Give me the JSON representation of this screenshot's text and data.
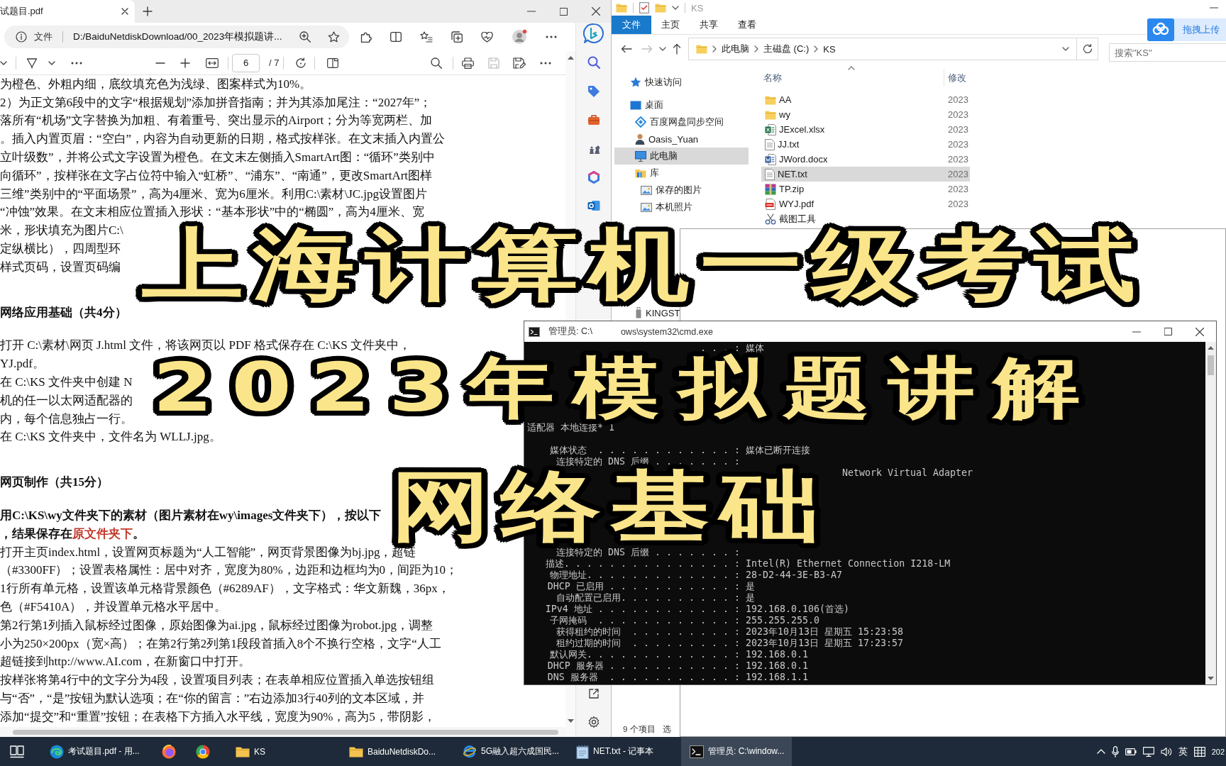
{
  "pdf_viewer": {
    "tab_title": "试题目.pdf",
    "address": {
      "scheme": "文件",
      "url": "D:/BaiduNetdiskDownload/00_2023年模拟题讲..."
    },
    "toolbar": {
      "page": "6",
      "total": "/ 7",
      "save_disabled": true
    },
    "lines": [
      {
        "kind": "text",
        "text": "为橙色、外粗内细，底纹填充色为浅绿、图案样式为10%。"
      },
      {
        "kind": "text",
        "text": "2）为正文第6段中的文字“根据规划”添加拼音指南；并为其添加尾注：“2027年”；"
      },
      {
        "kind": "text",
        "text": "落所有“机场”文字替换为加粗、有着重号、突出显示的Airport；分为等宽两栏、加"
      },
      {
        "kind": "text",
        "text": "。插入内置页眉：“空白”，内容为自动更新的日期，格式按样张。在文末插入内置公"
      },
      {
        "kind": "text",
        "text": "立叶级数”，并将公式文字设置为橙色。在文末左侧插入SmartArt图：“循环”类别中"
      },
      {
        "kind": "text",
        "text": "向循环”，按样张在文字占位符中输入“虹桥”、“浦东”、“南通”，更改SmartArt图样"
      },
      {
        "kind": "text",
        "text": "三维”类别中的“平面场景”，高为4厘米、宽为6厘米。利用C:\\素材\\JC.jpg设置图片"
      },
      {
        "kind": "text",
        "text": "“冲蚀”效果。在文末相应位置插入形状：“基本形状”中的“椭圆”，高为4厘米、宽"
      },
      {
        "kind": "text",
        "text": "米，形状填充为图片C:\\"
      },
      {
        "kind": "text",
        "text": "定纵横比），四周型环"
      },
      {
        "kind": "text",
        "text": "样式页码，设置页码编"
      },
      {
        "kind": "heading",
        "text": "网络应用基础（共4分）"
      },
      {
        "kind": "text",
        "text": "打开 C:\\素材\\网页 J.html 文件，将该网页以 PDF 格式保存在 C:\\KS 文件夹中，"
      },
      {
        "kind": "text",
        "text": "YJ.pdf。"
      },
      {
        "kind": "text",
        "text": "在 C:\\KS 文件夹中创建 N"
      },
      {
        "kind": "text",
        "text": "机的任一以太网适配器的"
      },
      {
        "kind": "text",
        "text": "内，每个信息独占一行。"
      },
      {
        "kind": "text",
        "text": "在 C:\\KS 文件夹中，文件名为 WLLJ.jpg。"
      },
      {
        "kind": "heading",
        "text": "网页制作（共15分）"
      },
      {
        "kind": "bold",
        "text": "用C:\\KS\\wy文件夹下的素材（图片素材在wy\\images文件夹下），按以下"
      },
      {
        "kind": "bold",
        "segments": [
          {
            "text": "，结果保存在",
            "highlight": false
          },
          {
            "text": "原文件夹下",
            "highlight": true
          },
          {
            "text": "。",
            "highlight": false
          }
        ]
      },
      {
        "kind": "text",
        "text": "打开主页index.html，设置网页标题为“人工智能”，网页背景图像为bj.jpg，超链"
      },
      {
        "kind": "text",
        "text": "（#3300FF）；设置表格属性：居中对齐，宽度为80%，边距和边框均为0，间距为10；"
      },
      {
        "kind": "text",
        "text": "1行所有单元格，设置该单元格背景颜色（#6289AF），文字格式：华文新魏，36px，"
      },
      {
        "kind": "text",
        "text": "色（#F5410A），并设置单元格水平居中。"
      },
      {
        "kind": "text",
        "text": "第2行第1列插入鼠标经过图像，原始图像为ai.jpg，鼠标经过图像为robot.jpg，调整"
      },
      {
        "kind": "text",
        "text": "小为250×200px（宽×高）；在第2行第2列第1段段首插入8个不换行空格，文字“人工"
      },
      {
        "kind": "text",
        "text": "超链接到http://www.AI.com，在新窗口中打开。"
      },
      {
        "kind": "text",
        "text": "按样张将第4行中的文字分为4段，设置项目列表；在表单相应位置插入单选按钮组"
      },
      {
        "kind": "text",
        "text": "与“否”，“是”按钮为默认选项；在“你的留言：”右边添加3行40列的文本区域，并"
      },
      {
        "kind": "text",
        "text": "添加“提交”和“重置”按钮；在表格下方插入水平线，宽度为90%，高为5，带阴影，"
      }
    ]
  },
  "explorer": {
    "title": "KS",
    "ribbon_tabs": [
      {
        "label": "文件",
        "selected": true
      },
      {
        "label": "主页",
        "selected": false
      },
      {
        "label": "共享",
        "selected": false
      },
      {
        "label": "查看",
        "selected": false
      }
    ],
    "forward_disabled": true,
    "breadcrumb": [
      "此电脑",
      "主磁盘 (C:)",
      "KS"
    ],
    "search": {
      "placeholder": "搜索\"KS\""
    },
    "upload_button": "拖拽上传",
    "nav": [
      {
        "label": "快速访问",
        "kind": "star",
        "selected": false
      },
      {
        "label": "桌面",
        "kind": "desktop",
        "selected": false,
        "children": [
          {
            "label": "百度网盘同步空间",
            "kind": "sync",
            "selected": false
          },
          {
            "label": "Oasis_Yuan",
            "kind": "user",
            "selected": false
          },
          {
            "label": "此电脑",
            "kind": "pc",
            "selected": true
          },
          {
            "label": "库",
            "kind": "library",
            "selected": false,
            "children": [
              {
                "label": "保存的图片",
                "kind": "picture",
                "selected": false
              },
              {
                "label": "本机照片",
                "kind": "picture",
                "selected": false
              }
            ]
          },
          {
            "label": "KINGST",
            "kind": "drive",
            "selected": false
          }
        ]
      }
    ],
    "columns": [
      "名称",
      "修改"
    ],
    "files": [
      {
        "name": "AA",
        "kind": "folder",
        "date": "2023",
        "selected": false
      },
      {
        "name": "wy",
        "kind": "folder",
        "date": "2023",
        "selected": false
      },
      {
        "name": "JExcel.xlsx",
        "kind": "spreadsheet",
        "date": "2023",
        "selected": false
      },
      {
        "name": "JJ.txt",
        "kind": "text",
        "date": "2023",
        "selected": false
      },
      {
        "name": "JWord.docx",
        "kind": "document",
        "date": "2023",
        "selected": false
      },
      {
        "name": "NET.txt",
        "kind": "text",
        "date": "2023",
        "selected": true
      },
      {
        "name": "TP.zip",
        "kind": "archive",
        "date": "2023",
        "selected": false
      },
      {
        "name": "WYJ.pdf",
        "kind": "pdf",
        "date": "2023",
        "selected": false
      },
      {
        "name": "截图工具",
        "kind": "shortcut",
        "selected": false
      }
    ],
    "status": {
      "count": "9 个项目",
      "selection": "选"
    }
  },
  "cmd": {
    "title_parts": [
      "管理员: C:\\",
      "ows\\system32\\cmd.exe"
    ],
    "sections": [
      {
        "lines": [
          {
            "kind": "entry",
            "label": ". . . :",
            "value": "媒体"
          }
        ]
      },
      {
        "lines": [
          {
            "kind": "header",
            "text": "适配器 本地连接* 1"
          },
          {
            "kind": "entry",
            "label": "媒体状态  . . . . . . . . . . . . :",
            "value": "媒体已断开连接"
          },
          {
            "kind": "entry",
            "label": "连接特定的 DNS 后缀 . . . . . . . :"
          }
        ]
      },
      {
        "lines": [
          {
            "kind": "tail",
            "value": "Network Virtual Adapter"
          }
        ]
      },
      {
        "lines": [
          {
            "kind": "entry",
            "label": "连接特定的 DNS 后缀 . . . . . . . :"
          },
          {
            "kind": "entry",
            "label": "描述. . . . . . . . . . . . . . . :",
            "value": "Intel(R) Ethernet Connection I218-LM"
          },
          {
            "kind": "entry",
            "label": "物理地址. . . . . . . . . . . . . :",
            "value": "28-D2-44-3E-B3-A7"
          },
          {
            "kind": "entry",
            "label": "DHCP 已启用 . . . . . . . . . . . :",
            "value": "是"
          },
          {
            "kind": "entry",
            "label": "自动配置已启用. . . . . . . . . . :",
            "value": "是"
          },
          {
            "kind": "entry",
            "label": "IPv4 地址 . . . . . . . . . . . . :",
            "value": "192.168.0.106(首选)"
          },
          {
            "kind": "entry",
            "label": "子网掩码  . . . . . . . . . . . . :",
            "value": "255.255.255.0"
          },
          {
            "kind": "entry",
            "label": "获得租约的时间  . . . . . . . . . :",
            "value": "2023年10月13日 星期五 15:23:58"
          },
          {
            "kind": "entry",
            "label": "租约过期的时间  . . . . . . . . . :",
            "value": "2023年10月13日 星期五 17:23:57"
          },
          {
            "kind": "entry",
            "label": "默认网关. . . . . . . . . . . . . :",
            "value": "192.168.0.1"
          },
          {
            "kind": "entry",
            "label": "DHCP 服务器 . . . . . . . . . . . :",
            "value": "192.168.0.1"
          },
          {
            "kind": "entry",
            "label": "DNS 服务器  . . . . . . . . . . . :",
            "value": "192.168.1.1"
          }
        ]
      }
    ]
  },
  "taskbar": {
    "items": [
      {
        "kind": "task_view",
        "selected": false
      },
      {
        "kind": "wave_browser",
        "label": "考试题目.pdf - 用...",
        "selected": false
      },
      {
        "kind": "fox_browser",
        "selected": false
      },
      {
        "kind": "ring_browser",
        "selected": false
      },
      {
        "kind": "folder",
        "label": "KS",
        "selected": false
      },
      {
        "kind": "folder",
        "label": "BaiduNetdiskDo...",
        "selected": false
      },
      {
        "kind": "e_browser",
        "label": "5G融入超六成国民...",
        "selected": false
      },
      {
        "kind": "notepad",
        "label": "NET.txt - 记事本",
        "selected": false
      },
      {
        "kind": "terminal",
        "label": "管理员: C:\\window...",
        "selected": true
      }
    ],
    "tray": {
      "language": "英",
      "clock": "202"
    }
  },
  "title_overlay": {
    "lines": [
      "上海计算机一级考试",
      "2023年模拟题讲解",
      "网络基础"
    ]
  }
}
